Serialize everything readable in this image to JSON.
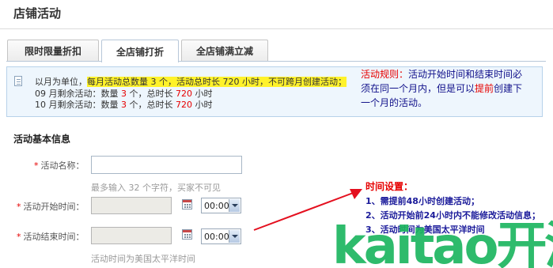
{
  "page": {
    "title": "店铺活动"
  },
  "tabs": [
    {
      "label": "限时限量折扣",
      "active": false
    },
    {
      "label": "全店铺打折",
      "active": true
    },
    {
      "label": "全店铺满立减",
      "active": false
    }
  ],
  "info": {
    "line1_prefix": "以月为单位，",
    "line1_highlight": "每月活动总数量 3 个，活动总时长 720 小时，不可跨月创建活动；",
    "line2_prefix": "09 月剩余活动：数量 ",
    "line2_count": "3",
    "line2_mid": " 个，总时长 ",
    "line2_hours": "720",
    "line2_suffix": " 小时",
    "line3_prefix": "10 月剩余活动：数量 ",
    "line3_count": "3",
    "line3_mid": " 个，总时长 ",
    "line3_hours": "720",
    "line3_suffix": " 小时"
  },
  "rules": {
    "label": "活动规则：",
    "text1": "活动开始时间和结束时间必须在同一个月内，但是可以",
    "emphasis": "提前",
    "text2": "创建下一个月的活动。"
  },
  "form": {
    "section_title": "活动基本信息",
    "required_mark": "*",
    "name_label": "活动名称：",
    "name_value": "",
    "name_hint": "最多输入 32 个字符，买家不可见",
    "start_label": "活动开始时间：",
    "start_date": "",
    "start_time": "00:00",
    "end_label": "活动结束时间：",
    "end_date": "",
    "end_time": "00:00",
    "timezone_hint": "活动时间为美国太平洋时间"
  },
  "time_settings": {
    "title": "时间设置：",
    "items": [
      "1、需提前48小时创建活动；",
      "2、活动开始前24小时内不能修改活动信息；",
      "3、活动时间为美国太平洋时间"
    ]
  },
  "watermark": {
    "text": "kaitao开淘"
  },
  "colors": {
    "accent_red": "#e60000",
    "rules_blue": "#10108a",
    "watermark_green": "#1cb55f",
    "highlight": "#fff22a"
  }
}
